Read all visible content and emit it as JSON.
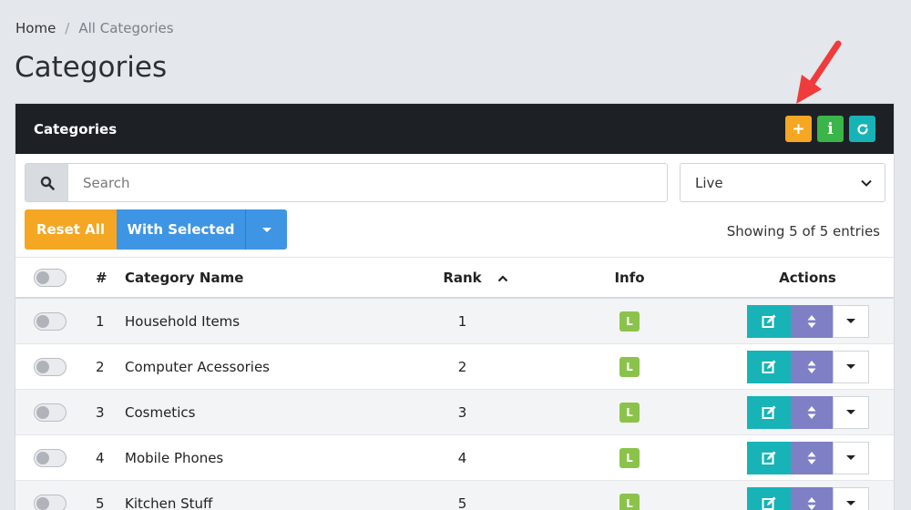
{
  "breadcrumb": {
    "home": "Home",
    "separator": "/",
    "current": "All Categories"
  },
  "page_title": "Categories",
  "card": {
    "title": "Categories",
    "header_buttons": {
      "add": "+",
      "info": "i",
      "refresh": "refresh-icon"
    }
  },
  "search": {
    "placeholder": "Search",
    "value": ""
  },
  "status_filter": {
    "selected": "Live"
  },
  "actions": {
    "reset_all": "Reset All",
    "with_selected": "With Selected"
  },
  "entries_text": "Showing 5 of 5 entries",
  "table": {
    "columns": {
      "num": "#",
      "name": "Category Name",
      "rank": "Rank",
      "info": "Info",
      "actions": "Actions"
    },
    "rows": [
      {
        "num": "1",
        "name": "Household Items",
        "rank": "1",
        "badge": "L"
      },
      {
        "num": "2",
        "name": "Computer Acessories",
        "rank": "2",
        "badge": "L"
      },
      {
        "num": "3",
        "name": "Cosmetics",
        "rank": "3",
        "badge": "L"
      },
      {
        "num": "4",
        "name": "Mobile Phones",
        "rank": "4",
        "badge": "L"
      },
      {
        "num": "5",
        "name": "Kitchen Stuff",
        "rank": "5",
        "badge": "L"
      }
    ]
  },
  "colors": {
    "orange": "#f5a623",
    "blue": "#3e95e3",
    "teal": "#17b3b7",
    "purple": "#7e7fc4",
    "green": "#8bc34a",
    "header_bg": "#1d2126"
  }
}
